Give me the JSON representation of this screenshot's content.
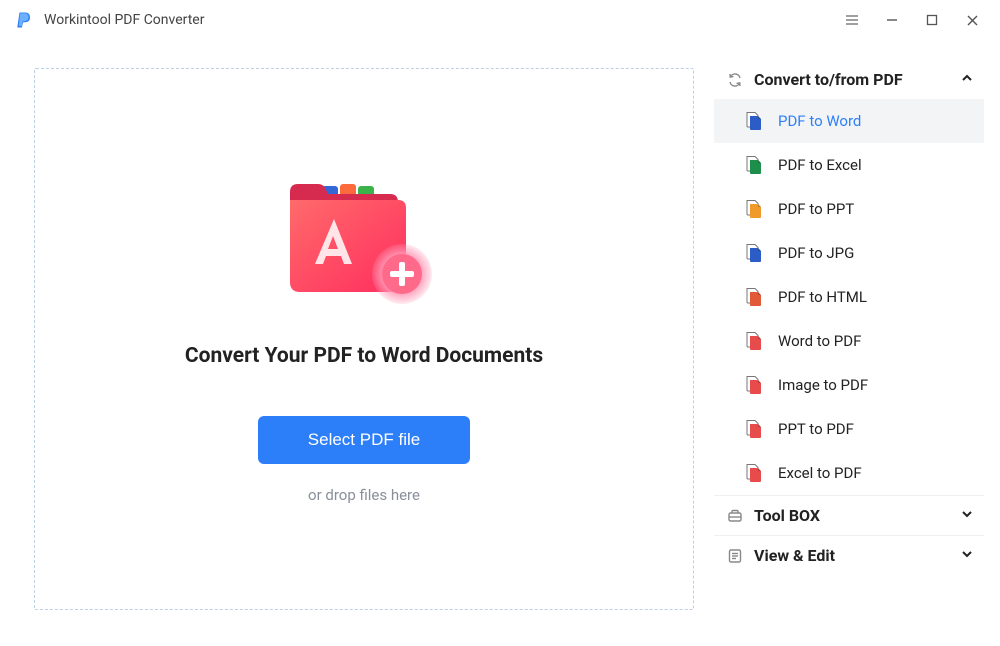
{
  "title": "Workintool PDF Converter",
  "main": {
    "heading": "Convert Your PDF to Word Documents",
    "select_button": "Select PDF file",
    "drop_hint": "or drop files here"
  },
  "sidebar": {
    "sections": [
      {
        "id": "convert",
        "label": "Convert to/from PDF",
        "expanded": true
      },
      {
        "id": "toolbox",
        "label": "Tool BOX",
        "expanded": false
      },
      {
        "id": "viewedit",
        "label": "View & Edit",
        "expanded": false
      }
    ],
    "convert_items": [
      {
        "label": "PDF to Word",
        "color": "#2c5cc5",
        "active": true
      },
      {
        "label": "PDF to Excel",
        "color": "#1d8f4a",
        "active": false
      },
      {
        "label": "PDF to PPT",
        "color": "#f09a2a",
        "active": false
      },
      {
        "label": "PDF to JPG",
        "color": "#2c5cc5",
        "active": false
      },
      {
        "label": "PDF to HTML",
        "color": "#e2593a",
        "active": false
      },
      {
        "label": "Word to PDF",
        "color": "#e84b4b",
        "active": false
      },
      {
        "label": "Image to PDF",
        "color": "#e84b4b",
        "active": false
      },
      {
        "label": "PPT to PDF",
        "color": "#e84b4b",
        "active": false
      },
      {
        "label": "Excel to PDF",
        "color": "#e84b4b",
        "active": false
      }
    ]
  }
}
